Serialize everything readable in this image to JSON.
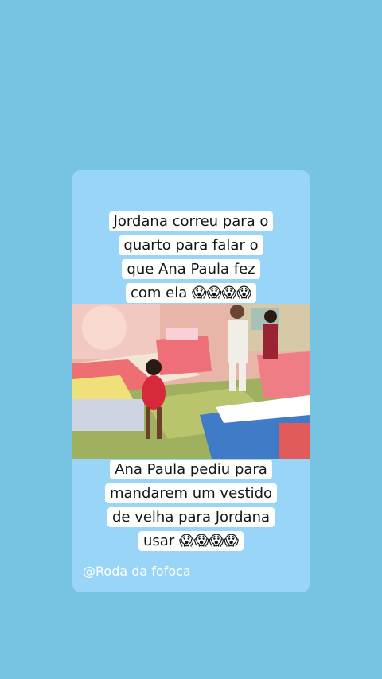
{
  "captions": {
    "top": {
      "lines": [
        "Jordana correu para o",
        "quarto para falar o",
        "que Ana Paula fez",
        "com ela 😱😱😱😱"
      ]
    },
    "bottom": {
      "lines": [
        "Ana Paula pediu para",
        "mandarem um vestido",
        "de velha para Jordana",
        "usar 😱😱😱😱"
      ]
    }
  },
  "handle": "@Roda da fofoca",
  "colors": {
    "background": "#76c3e2",
    "card": "#98d5f6",
    "caption_bg": "#ffffff"
  }
}
